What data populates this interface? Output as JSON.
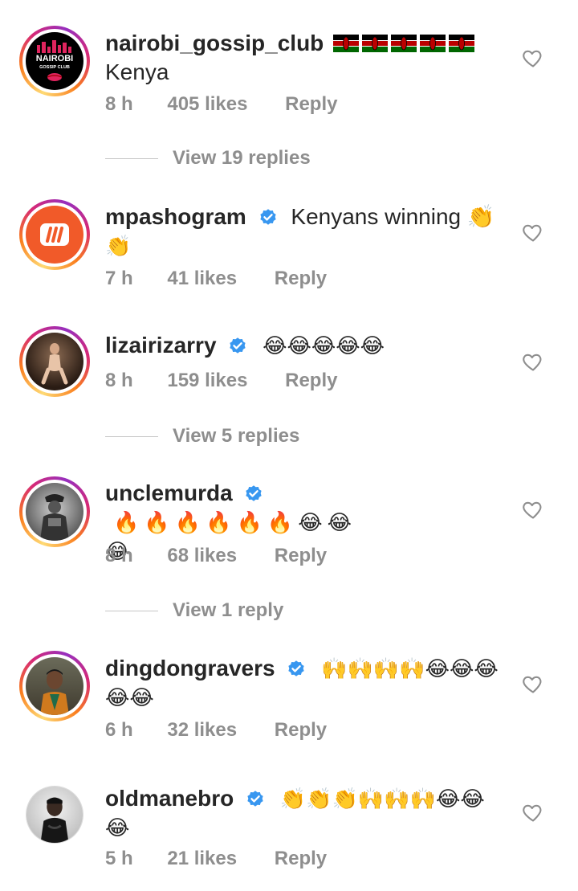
{
  "comments": [
    {
      "username": "nairobi_gossip_club",
      "verified": false,
      "text_inline": "",
      "text_line2": "Kenya",
      "time": "8 h",
      "likes": "405 likes",
      "reply": "Reply",
      "avatar_label": "NAIROBI",
      "avatar_sublabel": "GOSSIP CLUB",
      "view_replies": "View 19 replies"
    },
    {
      "username": "mpashogram",
      "verified": true,
      "text_inline": "Kenyans winning 👏",
      "text_line2": "👏",
      "time": "7 h",
      "likes": "41 likes",
      "reply": "Reply"
    },
    {
      "username": "lizairizarry",
      "verified": true,
      "text_inline": "😂😂😂😂😂",
      "time": "8 h",
      "likes": "159 likes",
      "reply": "Reply",
      "view_replies": "View 5 replies"
    },
    {
      "username": "unclemurda",
      "verified": true,
      "text_inline": "🔥🔥🔥🔥🔥🔥😂😂",
      "text_line2": "😂",
      "time": "8 h",
      "likes": "68 likes",
      "reply": "Reply",
      "view_replies": "View 1 reply"
    },
    {
      "username": "dingdongravers",
      "verified": true,
      "text_inline": "🙌🙌🙌🙌😂😂😂",
      "text_line2": "😂😂",
      "time": "6 h",
      "likes": "32 likes",
      "reply": "Reply"
    },
    {
      "username": "oldmanebro",
      "verified": true,
      "text_inline": "👏👏👏🙌🙌🙌😂😂",
      "text_line2": "😂",
      "time": "5 h",
      "likes": "21 likes",
      "reply": "Reply"
    }
  ],
  "colors": {
    "verified_blue": "#3897f0",
    "meta_gray": "#8e8e8e",
    "kenya_black": "#000000",
    "kenya_red": "#bb0000",
    "kenya_green": "#006600"
  },
  "icons": {
    "like": "heart-outline-icon",
    "verified": "verified-badge-icon",
    "flag": "kenya-flag-icon"
  }
}
